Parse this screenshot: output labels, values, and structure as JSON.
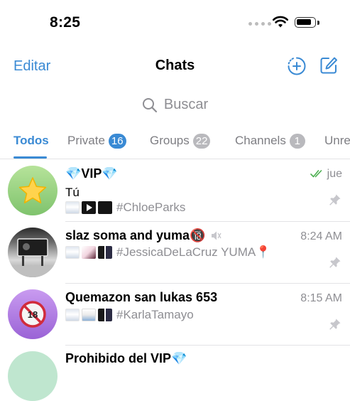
{
  "status_bar": {
    "time": "8:25"
  },
  "nav": {
    "edit_label": "Editar",
    "title": "Chats"
  },
  "search": {
    "placeholder": "Buscar"
  },
  "tabs": [
    {
      "label": "Todos",
      "badge": ""
    },
    {
      "label": "Private",
      "badge": "16"
    },
    {
      "label": "Groups",
      "badge": "22"
    },
    {
      "label": "Channels",
      "badge": "1"
    },
    {
      "label": "Unre",
      "badge": ""
    }
  ],
  "chats": [
    {
      "title": "💎VIP💎",
      "time": "jue",
      "sender": "Tú",
      "preview": "#ChloeParks",
      "read": true,
      "pinned": true,
      "muted": false
    },
    {
      "title": "slaz soma and yuma🔞",
      "time": "8:24 AM",
      "preview": "#JessicaDeLaCruz YUMA📍",
      "pinned": true,
      "muted": true
    },
    {
      "title": "Quemazon san lukas 653",
      "time": "8:15 AM",
      "preview": "#KarlaTamayo",
      "pinned": true,
      "muted": false
    },
    {
      "title": "Prohibido del VIP💎",
      "time": "",
      "preview": "",
      "pinned": true,
      "muted": false
    }
  ],
  "colors": {
    "accent": "#3a8ad4",
    "secondary_text": "#8e8e93",
    "read_check": "#4caf50"
  },
  "icons": {
    "status": [
      "wifi-icon",
      "battery-icon"
    ],
    "nav": [
      "new-story-icon",
      "compose-icon"
    ],
    "row": [
      "double-check-icon",
      "pin-icon",
      "mute-icon"
    ]
  }
}
